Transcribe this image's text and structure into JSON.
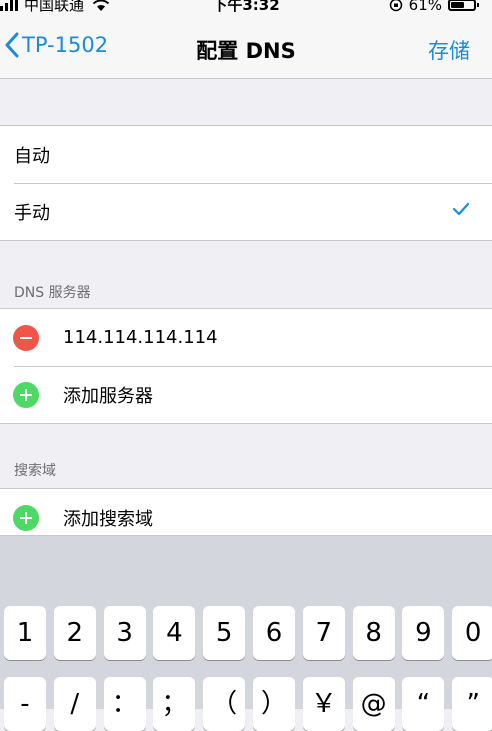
{
  "status_bar": {
    "carrier": "中国联通",
    "time": "下午3:32",
    "battery_percent": "61%",
    "battery_level": 0.61,
    "icons": [
      "signal-icon",
      "wifi-icon",
      "orientation-lock-icon",
      "battery-icon"
    ]
  },
  "nav": {
    "back_label": "TP-1502",
    "title": "配置 DNS",
    "save_label": "存储"
  },
  "mode_options": [
    {
      "label": "自动",
      "selected": false
    },
    {
      "label": "手动",
      "selected": true
    }
  ],
  "dns_section": {
    "header": "DNS 服务器",
    "server_value": "114.114.114.114",
    "add_label": "添加服务器"
  },
  "search_section": {
    "header": "搜索域",
    "add_label": "添加搜索域"
  },
  "keyboard": {
    "row1": [
      "1",
      "2",
      "3",
      "4",
      "5",
      "6",
      "7",
      "8",
      "9",
      "0"
    ],
    "row2": [
      "-",
      "/",
      "：",
      "；",
      "（",
      "）",
      "￥",
      "@",
      "“",
      "”"
    ]
  },
  "colors": {
    "accent": "#1a8cd8",
    "delete_red": "#f0554a",
    "add_green": "#4cd964",
    "background": "#efeff4"
  }
}
